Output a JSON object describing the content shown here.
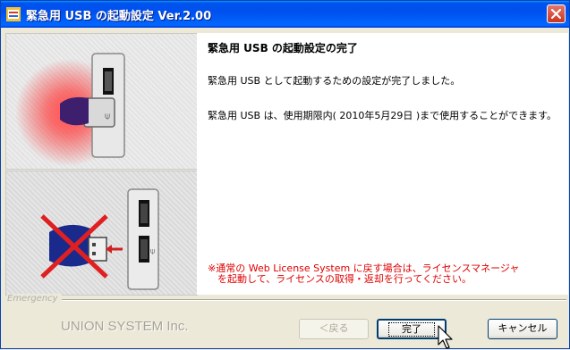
{
  "window": {
    "title": "緊急用 USB の起動設定 Ver.2.00",
    "icon": "app-icon",
    "close_icon": "close-icon"
  },
  "content": {
    "heading": "緊急用 USB の起動設定の完了",
    "paragraph1": "緊急用 USB として起動するための設定が完了しました。",
    "paragraph2": "緊急用 USB は、使用期限内( 2010年5月29日 )まで使用することができます。",
    "notice_line1": "※通常の Web License System に戻す場合は、ライセンスマネージャ",
    "notice_line2": "を起動して、ライセンスの取得・返却を行ってください。"
  },
  "footer": {
    "group_label": "Emergency",
    "company": "UNION SYSTEM Inc."
  },
  "buttons": {
    "back": "＜戻る",
    "finish": "完了",
    "cancel": "キャンセル"
  },
  "colors": {
    "titlebar": "#0054e3",
    "notice": "#e00000",
    "close": "#c9351e",
    "usb_glow": "#ff2020",
    "usb_drive": "#1a2a8c"
  }
}
